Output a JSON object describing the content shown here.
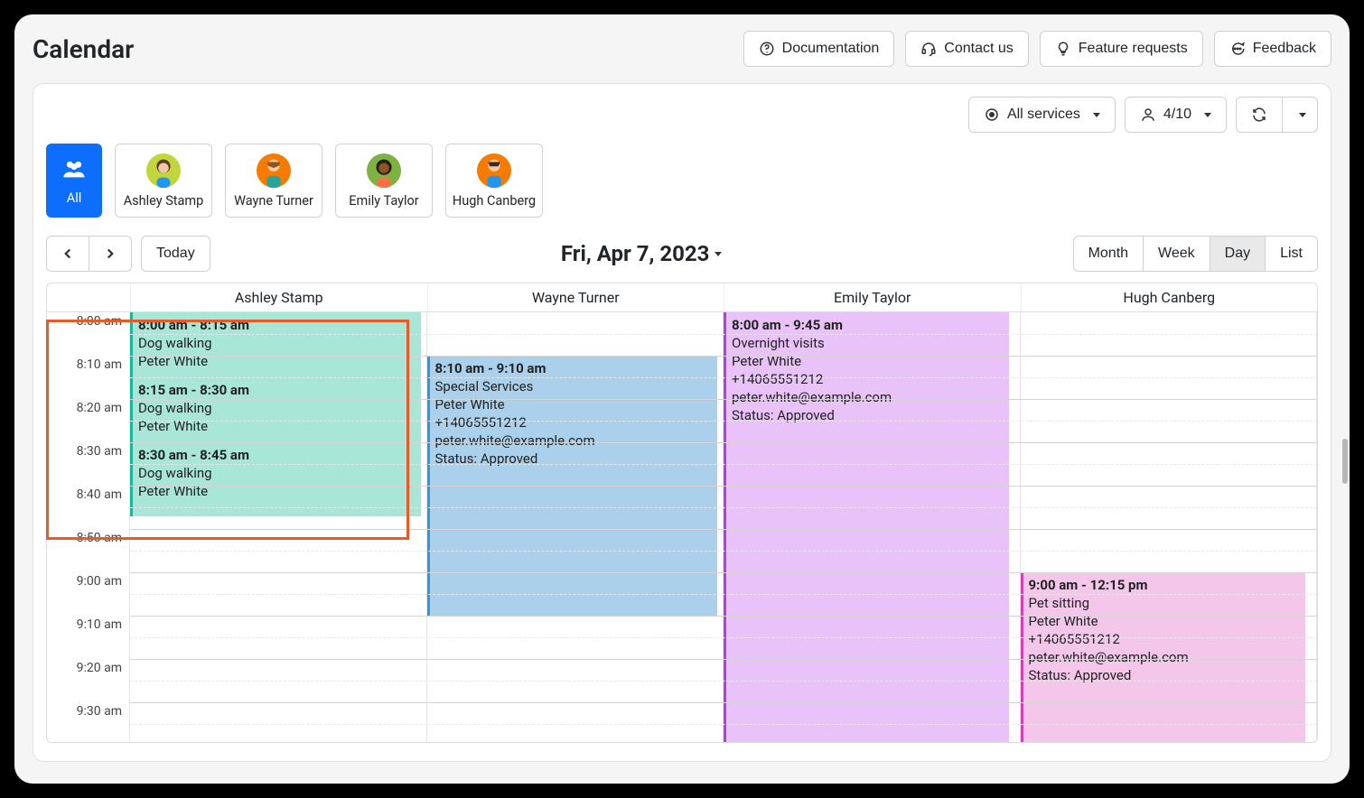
{
  "page_title": "Calendar",
  "topbar": {
    "doc": "Documentation",
    "contact": "Contact us",
    "feature": "Feature requests",
    "feedback": "Feedback"
  },
  "filters": {
    "services": "All services",
    "staff_count": "4/10"
  },
  "staff_tabs": {
    "all": "All",
    "items": [
      "Ashley Stamp",
      "Wayne Turner",
      "Emily Taylor",
      "Hugh Canberg"
    ]
  },
  "controls": {
    "today": "Today",
    "date_label": "Fri, Apr 7, 2023",
    "views": {
      "month": "Month",
      "week": "Week",
      "day": "Day",
      "list": "List"
    }
  },
  "columns": [
    "Ashley Stamp",
    "Wayne Turner",
    "Emily Taylor",
    "Hugh Canberg"
  ],
  "time_slots": [
    "8:00 am",
    "8:10 am",
    "8:20 am",
    "8:30 am",
    "8:40 am",
    "8:50 am",
    "9:00 am",
    "9:10 am",
    "9:20 am",
    "9:30 am"
  ],
  "events": {
    "ashley": [
      {
        "time": "8:00 am - 8:15 am",
        "service": "Dog walking",
        "client": "Peter White"
      },
      {
        "time": "8:15 am - 8:30 am",
        "service": "Dog walking",
        "client": "Peter White"
      },
      {
        "time": "8:30 am - 8:45 am",
        "service": "Dog walking",
        "client": "Peter White"
      }
    ],
    "wayne": {
      "time": "8:10 am - 9:10 am",
      "service": "Special Services",
      "client": "Peter White",
      "phone": "+14065551212",
      "email": "peter.white@example.com",
      "status": "Status: Approved"
    },
    "emily": {
      "time": "8:00 am - 9:45 am",
      "service": "Overnight visits",
      "client": "Peter White",
      "phone": "+14065551212",
      "email": "peter.white@example.com",
      "status": "Status: Approved"
    },
    "hugh": {
      "time": "9:00 am - 12:15 pm",
      "service": "Pet sitting",
      "client": "Peter White",
      "phone": "+14065551212",
      "email": "peter.white@example.com",
      "status": "Status: Approved"
    }
  }
}
